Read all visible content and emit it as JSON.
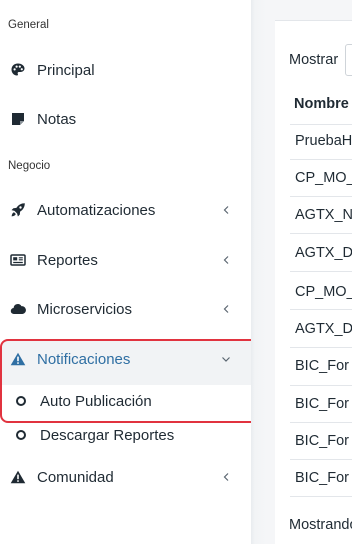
{
  "sidebar": {
    "sections": {
      "general": "General",
      "negocio": "Negocio"
    },
    "items": {
      "principal": "Principal",
      "notas": "Notas",
      "automatizaciones": "Automatizaciones",
      "reportes": "Reportes",
      "microservicios": "Microservicios",
      "notificaciones": "Notificaciones",
      "comunidad": "Comunidad"
    },
    "subitems": {
      "auto_publicacion": "Auto Publicación",
      "descargar_reportes": "Descargar Reportes"
    },
    "icons": {
      "principal": "palette-icon",
      "notas": "note-icon",
      "automatizaciones": "rocket-icon",
      "reportes": "newspaper-icon",
      "microservicios": "cloud-icon",
      "notificaciones": "warning-icon",
      "comunidad": "warning-icon"
    },
    "colors": {
      "active": "#2f6fa3",
      "highlight_border": "#e1333f"
    }
  },
  "content": {
    "show_label": "Mostrar",
    "column_header": "Nombre",
    "rows": [
      "PruebaH",
      "CP_MO_",
      "AGTX_N",
      "AGTX_D",
      "CP_MO_",
      "AGTX_D",
      "BIC_For",
      "BIC_For",
      "BIC_For",
      "BIC_For"
    ],
    "footer": "Mostrando"
  }
}
